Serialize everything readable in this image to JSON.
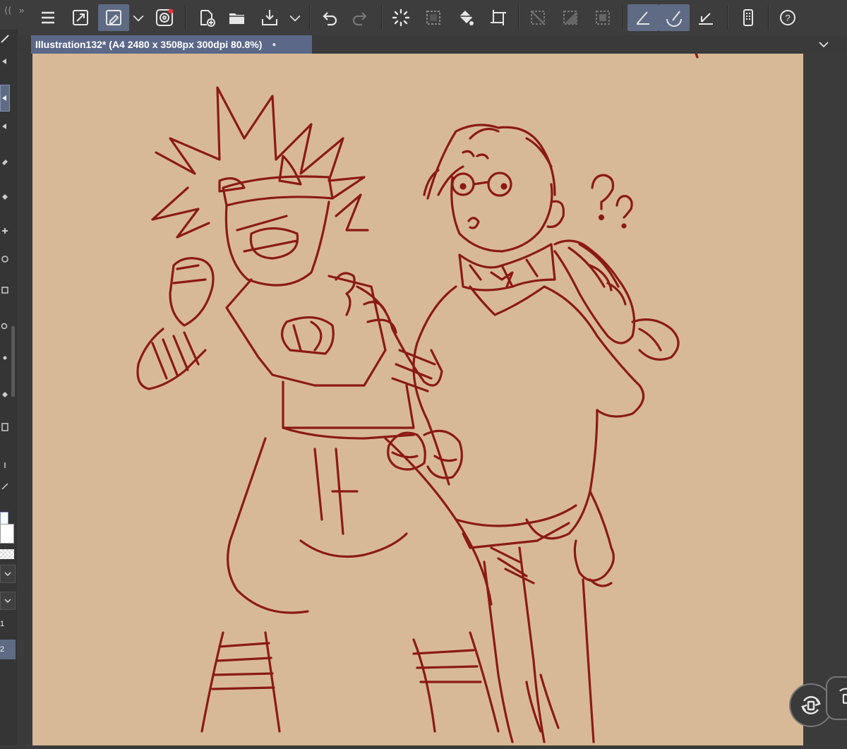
{
  "colors": {
    "app_bg": "#3b3b3b",
    "toolbar_bg": "#3d3d3d",
    "active_blue": "#5f6b84",
    "paper": "#d8b997",
    "sketch_line": "#8b1a14"
  },
  "command_bar": {
    "buttons": [
      {
        "name": "menu-icon"
      },
      {
        "name": "fit-screen-icon"
      },
      {
        "name": "transform-icon",
        "active": true
      },
      {
        "name": "dropdown-icon"
      },
      {
        "name": "circle-target-icon"
      },
      {
        "name": "new-file-icon"
      },
      {
        "name": "open-folder-icon"
      },
      {
        "name": "export-icon"
      },
      {
        "name": "dropdown-icon"
      },
      {
        "name": "undo-icon"
      },
      {
        "name": "redo-icon"
      },
      {
        "name": "loading-spinner-icon"
      },
      {
        "name": "selection-icon"
      },
      {
        "name": "fill-icon"
      },
      {
        "name": "crop-icon"
      },
      {
        "name": "clear-selection-icon"
      },
      {
        "name": "invert-selection-icon"
      },
      {
        "name": "frame-icon"
      },
      {
        "name": "ruler-snap-icon",
        "active": true
      },
      {
        "name": "brush-icon",
        "active": true
      },
      {
        "name": "pen-icon"
      },
      {
        "name": "device-icon"
      },
      {
        "name": "help-icon"
      }
    ]
  },
  "document": {
    "tab_title": "Illustration132* (A4 2480 x 3508px 300dpi 80.8%)",
    "modified_dot": "●"
  },
  "left_panel": {
    "layer_numbers": [
      "1",
      "2"
    ]
  }
}
